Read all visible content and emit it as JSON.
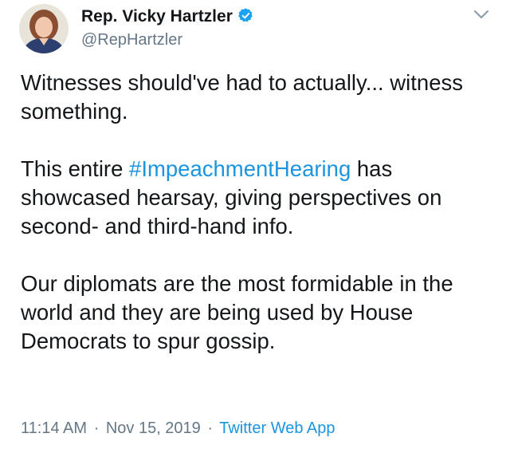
{
  "author": {
    "display_name": "Rep. Vicky Hartzler",
    "handle": "@RepHartzler",
    "verified": true
  },
  "tweet": {
    "paragraph1": "Witnesses should've had to actually... witness something.",
    "paragraph2_before": "This entire ",
    "hashtag": "#ImpeachmentHearing",
    "paragraph2_after": " has showcased hearsay, giving perspectives on second- and third-hand info.",
    "paragraph3": "Our diplomats are the most formidable in the world and they are being used by House Democrats to spur gossip."
  },
  "meta": {
    "time": "11:14 AM",
    "separator1": "·",
    "date": "Nov 15, 2019",
    "separator2": "·",
    "source": "Twitter Web App"
  },
  "colors": {
    "text": "#14171a",
    "secondary": "#657786",
    "link": "#1b95e0",
    "verified_badge": "#1da1f2"
  },
  "icons": {
    "verified": "verified-badge-icon",
    "caret": "chevron-down-icon"
  }
}
